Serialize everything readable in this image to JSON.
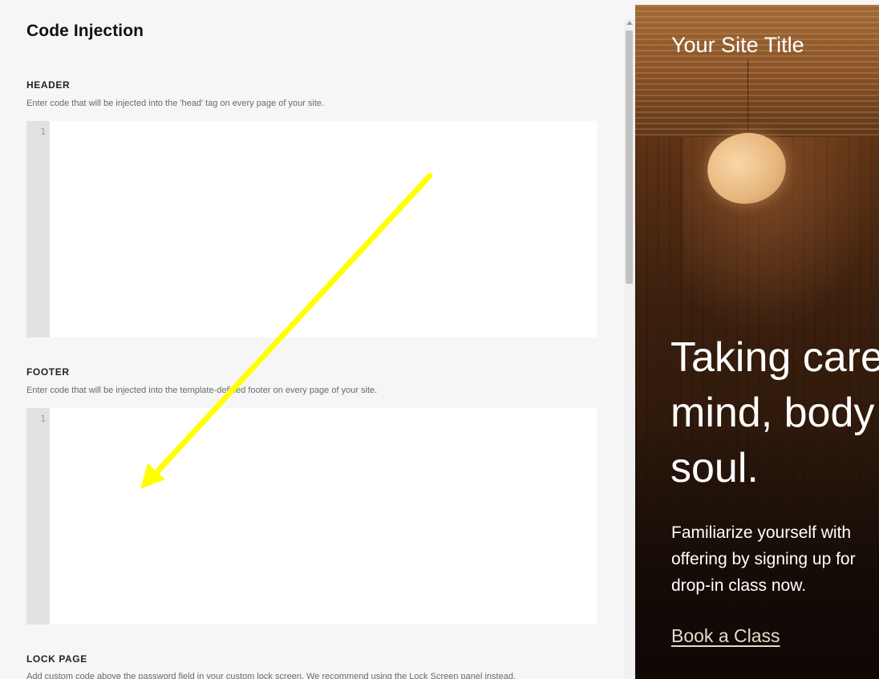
{
  "panel": {
    "title": "Code Injection",
    "header_section": {
      "label": "HEADER",
      "description": "Enter code that will be injected into the 'head' tag on every page of your site.",
      "line_number": "1",
      "value": ""
    },
    "footer_section": {
      "label": "FOOTER",
      "description": "Enter code that will be injected into the template-defined footer on every page of your site.",
      "line_number": "1",
      "value": ""
    },
    "lock_page_section": {
      "label": "LOCK PAGE",
      "description": "Add custom code above the password field in your custom lock screen. We recommend using the Lock Screen panel instead."
    }
  },
  "preview": {
    "site_title": "Your Site Title",
    "headline_lines": [
      "Taking care",
      "mind, body",
      "soul."
    ],
    "subtext_lines": [
      "Familiarize yourself with",
      "offering by signing up for",
      "drop-in class now."
    ],
    "cta_label": "Book a Class"
  },
  "annotation": {
    "arrow_color": "#ffff00"
  }
}
